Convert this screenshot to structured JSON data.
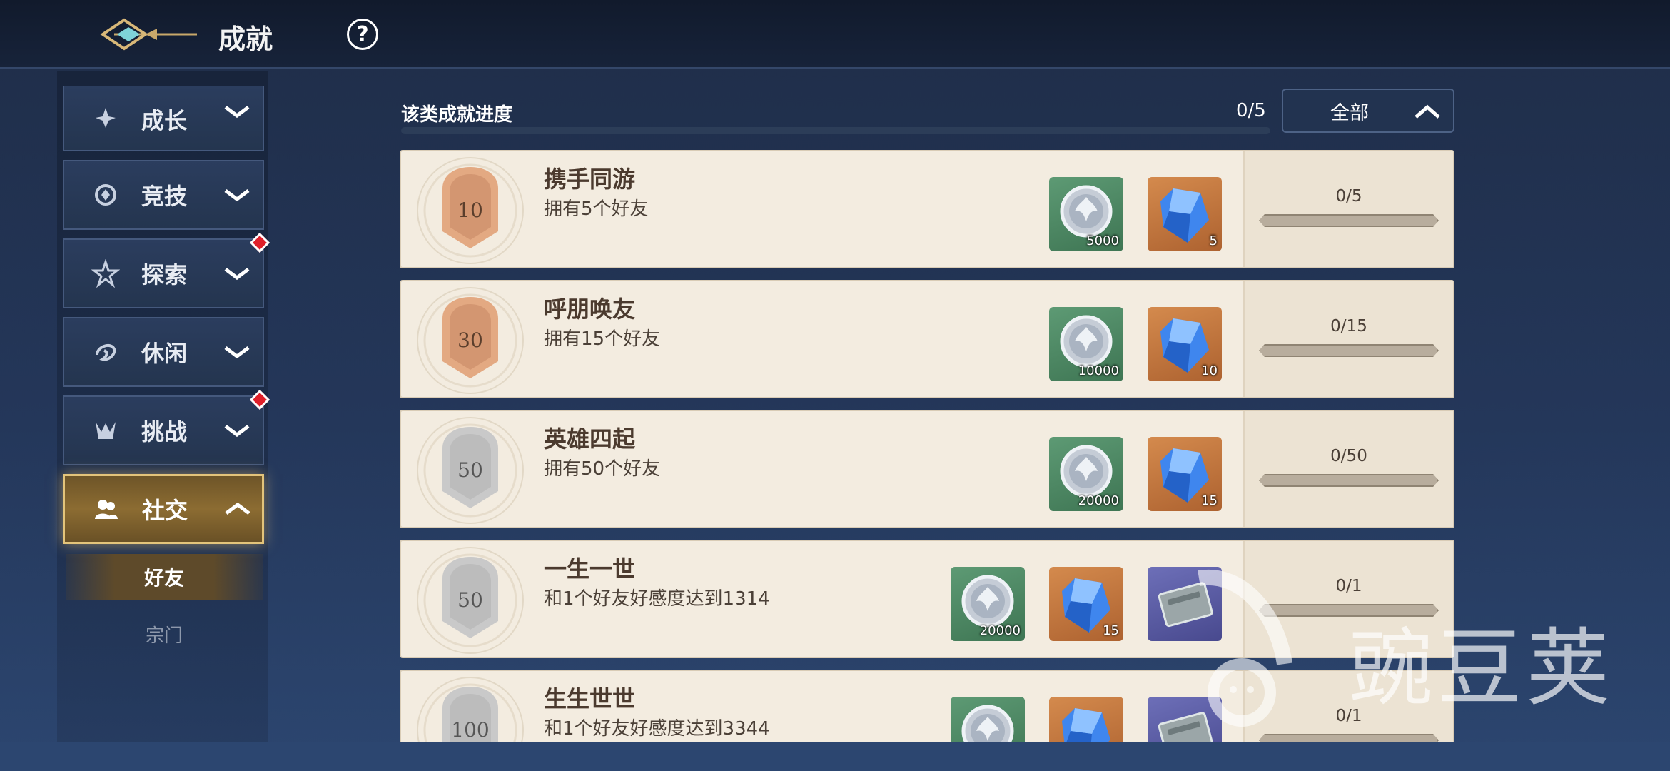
{
  "header": {
    "title": "成就"
  },
  "sidebar": {
    "categories": [
      {
        "label": "成长",
        "icon": "growth-icon",
        "has_alert": false
      },
      {
        "label": "竞技",
        "icon": "arena-icon",
        "has_alert": false
      },
      {
        "label": "探索",
        "icon": "explore-icon",
        "has_alert": true
      },
      {
        "label": "休闲",
        "icon": "leisure-icon",
        "has_alert": false
      },
      {
        "label": "挑战",
        "icon": "challenge-icon",
        "has_alert": true
      },
      {
        "label": "社交",
        "icon": "social-icon",
        "has_alert": false,
        "active": true
      }
    ],
    "sub_items": [
      {
        "label": "好友",
        "active": true
      },
      {
        "label": "宗门",
        "active": false
      }
    ]
  },
  "progress": {
    "label": "该类成就进度",
    "count": "0/5",
    "fraction": 0
  },
  "filter": {
    "label": "全部"
  },
  "achievements": [
    {
      "medal": "10",
      "medal_style": "bronze",
      "title": "携手同游",
      "desc": "拥有5个好友",
      "rewards": [
        {
          "type": "silver-coin",
          "qty": "5000"
        },
        {
          "type": "blue-crystal",
          "qty": "5"
        }
      ],
      "progress": "0/5",
      "fraction": 0
    },
    {
      "medal": "30",
      "medal_style": "bronze",
      "title": "呼朋唤友",
      "desc": "拥有15个好友",
      "rewards": [
        {
          "type": "silver-coin",
          "qty": "10000"
        },
        {
          "type": "blue-crystal",
          "qty": "10"
        }
      ],
      "progress": "0/15",
      "fraction": 0
    },
    {
      "medal": "50",
      "medal_style": "silver",
      "title": "英雄四起",
      "desc": "拥有50个好友",
      "rewards": [
        {
          "type": "silver-coin",
          "qty": "20000"
        },
        {
          "type": "blue-crystal",
          "qty": "15"
        }
      ],
      "progress": "0/50",
      "fraction": 0
    },
    {
      "medal": "50",
      "medal_style": "silver",
      "title": "一生一世",
      "desc": "和1个好友好感度达到1314",
      "rewards": [
        {
          "type": "silver-coin",
          "qty": "20000"
        },
        {
          "type": "blue-crystal",
          "qty": "15"
        },
        {
          "type": "purple-item",
          "qty": ""
        }
      ],
      "progress": "0/1",
      "fraction": 0
    },
    {
      "medal": "100",
      "medal_style": "silver",
      "title": "生生世世",
      "desc": "和1个好友好感度达到3344",
      "rewards": [
        {
          "type": "silver-coin",
          "qty": ""
        },
        {
          "type": "blue-crystal",
          "qty": ""
        },
        {
          "type": "purple-item",
          "qty": ""
        }
      ],
      "progress": "0/1",
      "fraction": 0
    }
  ],
  "watermark": {
    "text": "豌豆荚"
  }
}
